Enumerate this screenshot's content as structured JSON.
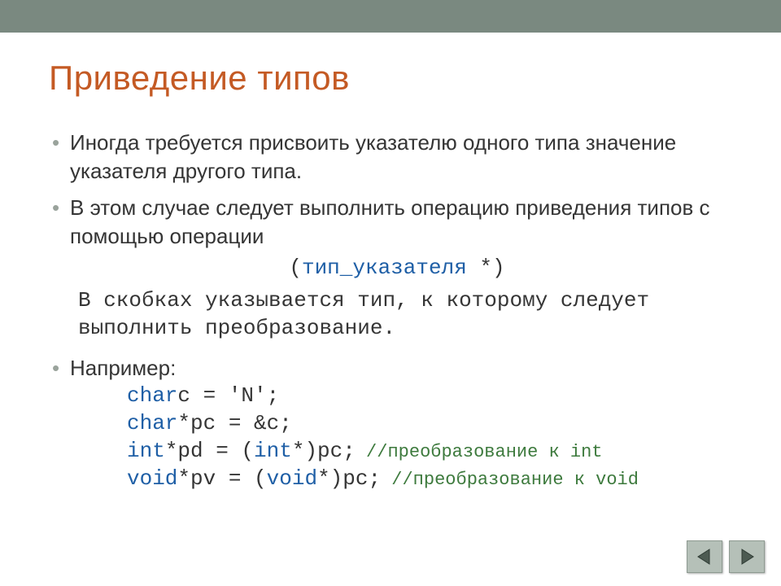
{
  "title": "Приведение типов",
  "bullets": {
    "b1": "Иногда требуется присвоить указателю одного типа значение указателя другого типа.",
    "b2": "В этом случае следует выполнить операцию приведения типов с помощью операции",
    "b3": "Например:"
  },
  "cast_expr": {
    "open": "(",
    "kw": "тип_указателя",
    "rest": " *)"
  },
  "note": "В скобках указывается тип, к которому следует выполнить преобразование.",
  "code": {
    "l1": {
      "kw": "char",
      "rest": "c = 'N';"
    },
    "l2": {
      "kw": "char",
      "rest": "*pc = &c;"
    },
    "l3": {
      "kw1": "int",
      "mid": "*pd = (",
      "kw2": "int",
      "rest": "*)pc;",
      "comment": " //преобразование к int"
    },
    "l4": {
      "kw1": "void",
      "mid": "*pv = (",
      "kw2": "void",
      "rest": "*)pc;",
      "comment": " //преобразование к void"
    }
  }
}
